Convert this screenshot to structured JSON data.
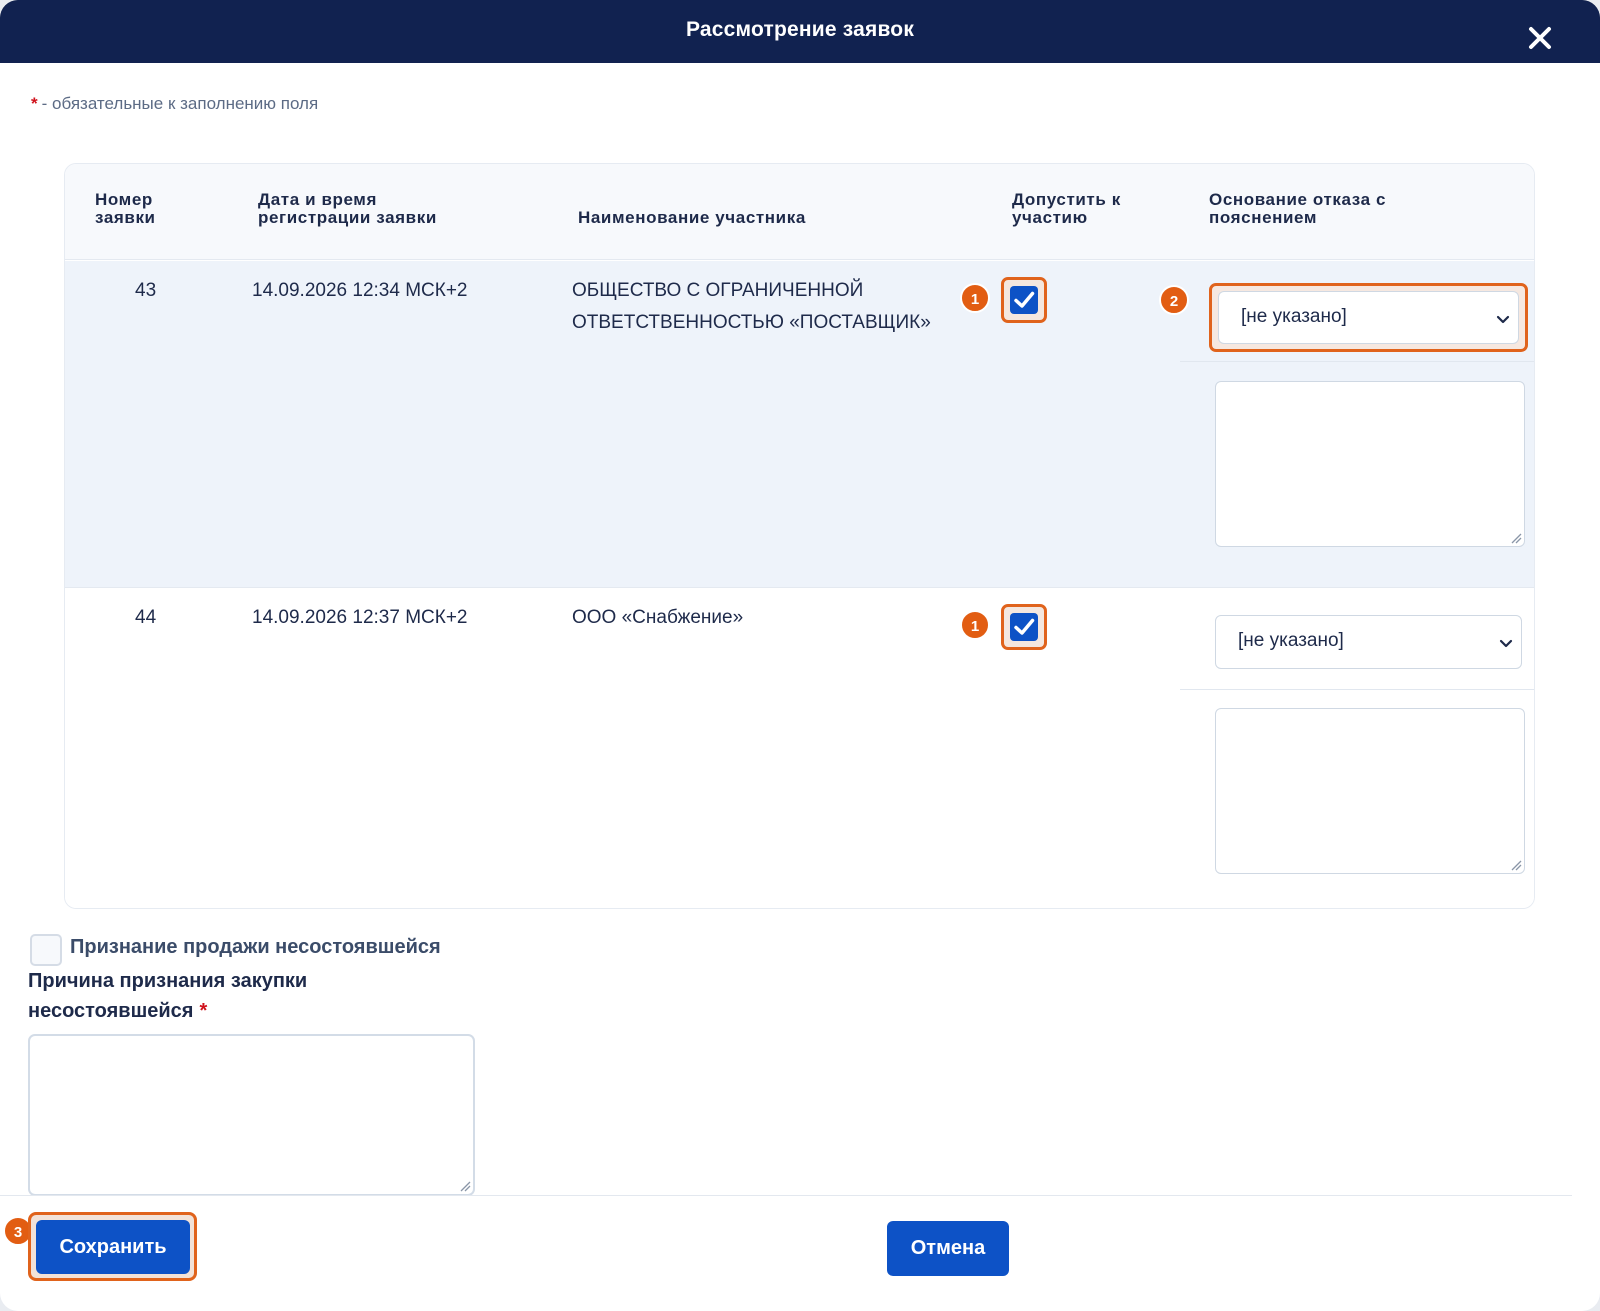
{
  "dialog": {
    "title": "Рассмотрение заявок",
    "close_icon": "close-icon"
  },
  "required_note": {
    "star": "*",
    "text": "- обязательные к заполнению поля"
  },
  "table": {
    "headers": {
      "number": "Номер заявки",
      "datetime": "Дата и время регистрации заявки",
      "participant": "Наименование участника",
      "admit": "Допустить к участию",
      "reason": "Основание отказа с пояснением"
    },
    "rows": [
      {
        "number": "43",
        "datetime": "14.09.2026 12:34 МСК+2",
        "participant": "ОБЩЕСТВО С ОГРАНИЧЕННОЙ ОТВЕТСТВЕННОСТЬЮ «ПОСТАВЩИК»",
        "admitted": true,
        "reason_select": "[не указано]",
        "reason_comment": ""
      },
      {
        "number": "44",
        "datetime": "14.09.2026 12:37 МСК+2",
        "participant": "ООО «Снабжение»",
        "admitted": true,
        "reason_select": "[не указано]",
        "reason_comment": ""
      }
    ]
  },
  "badges": {
    "admit": "1",
    "reason": "2",
    "save": "3"
  },
  "failed_sale": {
    "label": "Признание продажи несостоявшейся",
    "checked": false
  },
  "failure_reason": {
    "label": "Причина признания закупки несостоявшейся",
    "star": "*",
    "value": ""
  },
  "buttons": {
    "save": "Сохранить",
    "cancel": "Отмена"
  },
  "colors": {
    "header_bg": "#112250",
    "primary": "#0d52c6",
    "highlight": "#e0631c",
    "required": "#d0121c"
  }
}
